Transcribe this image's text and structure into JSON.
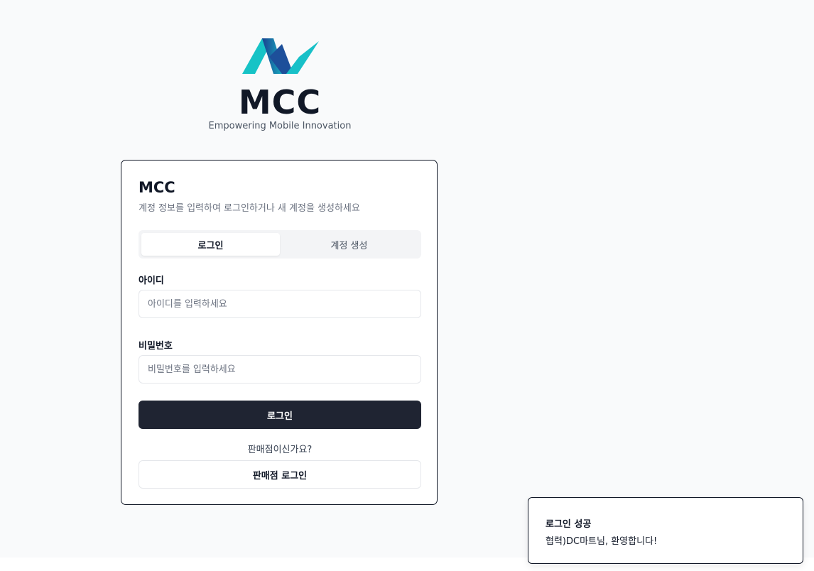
{
  "brand": {
    "logo_icon": "mcc-logo-icon",
    "name": "MCC",
    "tagline": "Empowering Mobile Innovation"
  },
  "card": {
    "title": "MCC",
    "description": "계정 정보를 입력하여 로그인하거나 새 계정을 생성하세요",
    "tabs": [
      {
        "label": "로그인",
        "active": true
      },
      {
        "label": "계정 생성",
        "active": false
      }
    ],
    "id_field": {
      "label": "아이디",
      "value": "",
      "placeholder": "아이디를 입력하세요"
    },
    "password_field": {
      "label": "비밀번호",
      "value": "",
      "placeholder": "비밀번호를 입력하세요"
    },
    "login_button": "로그인",
    "store_question": "판매점이신가요?",
    "store_login_button": "판매점 로그인"
  },
  "toast": {
    "title": "로그인 성공",
    "message": "협력)DC마트님, 환영합니다!"
  },
  "colors": {
    "page_bg": "#f9fafb",
    "primary": "#1f2432",
    "logo_teal": "#1fc8c8",
    "logo_blue": "#1d4f9a"
  }
}
